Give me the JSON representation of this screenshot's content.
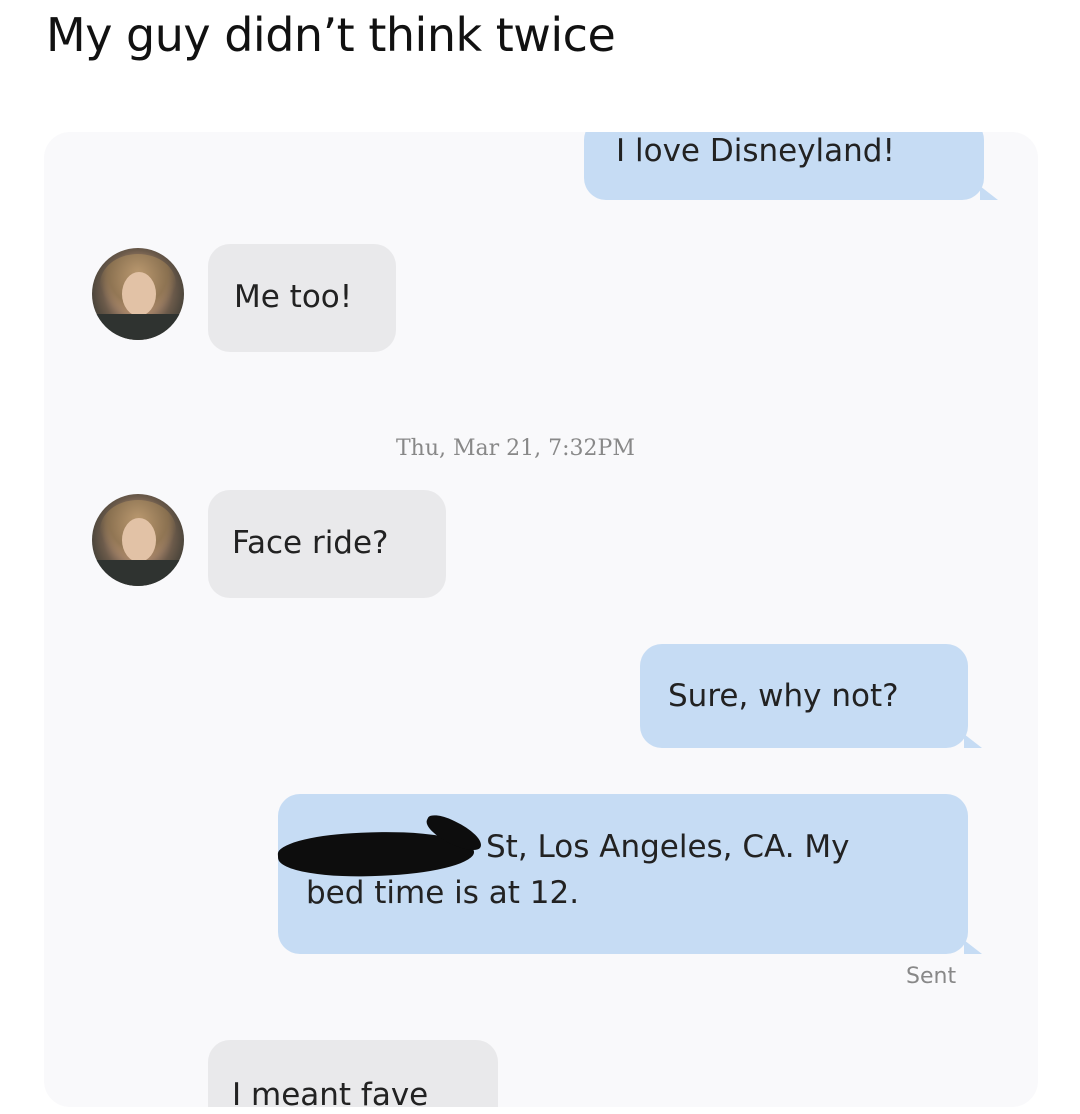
{
  "caption": "My guy didn’t think twice",
  "messages": [
    {
      "text": "I love Disneyland!"
    },
    {
      "text": "Me too!"
    },
    {
      "text": "Face ride?"
    },
    {
      "text": "Sure, why not?"
    },
    {
      "line1": "St, Los Angeles, CA. My",
      "line2": "bed time is at 12."
    },
    {
      "text": "I meant fave"
    }
  ],
  "timestamp": "Thu, Mar 21, 7:32PM",
  "status": "Sent",
  "colors": {
    "sent_bubble": "#c6dcf4",
    "received_bubble": "#e9e9eb",
    "chat_background": "#f9f9fb",
    "timestamp_text": "#888888"
  }
}
